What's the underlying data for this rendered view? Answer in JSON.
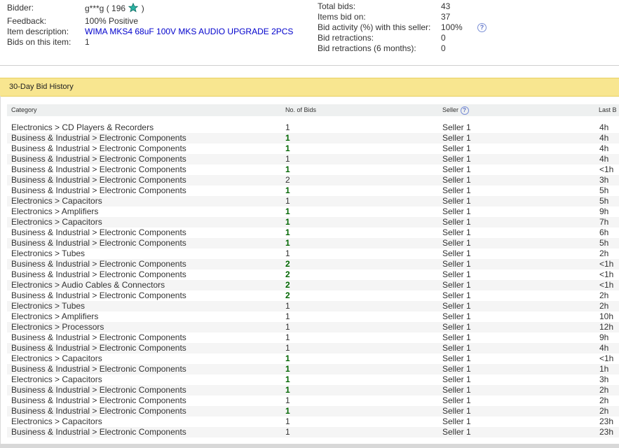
{
  "summary": {
    "bidder_label": "Bidder:",
    "bidder_name": "g***g",
    "bidder_score": "( 196",
    "bidder_score_close": ")",
    "feedback_label": "Feedback:",
    "feedback_value": "100% Positive",
    "item_desc_label": "Item description:",
    "item_desc_value": "WIMA MKS4 68uF 100V MKS AUDIO UPGRADE 2PCS",
    "bids_on_item_label": "Bids on this item:",
    "bids_on_item_value": "1",
    "total_bids_label": "Total bids:",
    "total_bids_value": "43",
    "items_bid_on_label": "Items bid on:",
    "items_bid_on_value": "37",
    "bid_activity_label": "Bid activity (%) with this seller:",
    "bid_activity_value": "100%",
    "bid_retractions_label": "Bid retractions:",
    "bid_retractions_value": "0",
    "bid_retractions_6m_label": "Bid retractions (6 months):",
    "bid_retractions_6m_value": "0"
  },
  "history": {
    "title": "30-Day Bid History",
    "columns": {
      "category": "Category",
      "bids": "No. of Bids",
      "seller": "Seller",
      "last": "Last B"
    },
    "rows": [
      {
        "category": "Electronics > CD Players & Recorders",
        "bids": "1",
        "seller": "Seller 1",
        "last": "4h",
        "green": false
      },
      {
        "category": "Business & Industrial > Electronic Components",
        "bids": "1",
        "seller": "Seller 1",
        "last": "4h",
        "green": true
      },
      {
        "category": "Business & Industrial > Electronic Components",
        "bids": "1",
        "seller": "Seller 1",
        "last": "4h",
        "green": true
      },
      {
        "category": "Business & Industrial > Electronic Components",
        "bids": "1",
        "seller": "Seller 1",
        "last": "4h",
        "green": false
      },
      {
        "category": "Business & Industrial > Electronic Components",
        "bids": "1",
        "seller": "Seller 1",
        "last": "<1h",
        "green": true
      },
      {
        "category": "Business & Industrial > Electronic Components",
        "bids": "2",
        "seller": "Seller 1",
        "last": "3h",
        "green": false
      },
      {
        "category": "Business & Industrial > Electronic Components",
        "bids": "1",
        "seller": "Seller 1",
        "last": "5h",
        "green": true
      },
      {
        "category": "Electronics > Capacitors",
        "bids": "1",
        "seller": "Seller 1",
        "last": "5h",
        "green": false
      },
      {
        "category": "Electronics > Amplifiers",
        "bids": "1",
        "seller": "Seller 1",
        "last": "9h",
        "green": true
      },
      {
        "category": "Electronics > Capacitors",
        "bids": "1",
        "seller": "Seller 1",
        "last": "7h",
        "green": true
      },
      {
        "category": "Business & Industrial > Electronic Components",
        "bids": "1",
        "seller": "Seller 1",
        "last": "6h",
        "green": true
      },
      {
        "category": "Business & Industrial > Electronic Components",
        "bids": "1",
        "seller": "Seller 1",
        "last": "5h",
        "green": true
      },
      {
        "category": "Electronics > Tubes",
        "bids": "1",
        "seller": "Seller 1",
        "last": "2h",
        "green": false
      },
      {
        "category": "Business & Industrial > Electronic Components",
        "bids": "2",
        "seller": "Seller 1",
        "last": "<1h",
        "green": true
      },
      {
        "category": "Business & Industrial > Electronic Components",
        "bids": "2",
        "seller": "Seller 1",
        "last": "<1h",
        "green": true
      },
      {
        "category": "Electronics > Audio Cables & Connectors",
        "bids": "2",
        "seller": "Seller 1",
        "last": "<1h",
        "green": true
      },
      {
        "category": "Business & Industrial > Electronic Components",
        "bids": "2",
        "seller": "Seller 1",
        "last": "2h",
        "green": true
      },
      {
        "category": "Electronics > Tubes",
        "bids": "1",
        "seller": "Seller 1",
        "last": "2h",
        "green": false
      },
      {
        "category": "Electronics > Amplifiers",
        "bids": "1",
        "seller": "Seller 1",
        "last": "10h",
        "green": false
      },
      {
        "category": "Electronics > Processors",
        "bids": "1",
        "seller": "Seller 1",
        "last": "12h",
        "green": false
      },
      {
        "category": "Business & Industrial > Electronic Components",
        "bids": "1",
        "seller": "Seller 1",
        "last": "9h",
        "green": false
      },
      {
        "category": "Business & Industrial > Electronic Components",
        "bids": "1",
        "seller": "Seller 1",
        "last": "4h",
        "green": false
      },
      {
        "category": "Electronics > Capacitors",
        "bids": "1",
        "seller": "Seller 1",
        "last": "<1h",
        "green": true
      },
      {
        "category": "Business & Industrial > Electronic Components",
        "bids": "1",
        "seller": "Seller 1",
        "last": "1h",
        "green": true
      },
      {
        "category": "Electronics > Capacitors",
        "bids": "1",
        "seller": "Seller 1",
        "last": "3h",
        "green": true
      },
      {
        "category": "Business & Industrial > Electronic Components",
        "bids": "1",
        "seller": "Seller 1",
        "last": "2h",
        "green": true
      },
      {
        "category": "Business & Industrial > Electronic Components",
        "bids": "1",
        "seller": "Seller 1",
        "last": "2h",
        "green": false
      },
      {
        "category": "Business & Industrial > Electronic Components",
        "bids": "1",
        "seller": "Seller 1",
        "last": "2h",
        "green": true
      },
      {
        "category": "Electronics > Capacitors",
        "bids": "1",
        "seller": "Seller 1",
        "last": "23h",
        "green": false
      },
      {
        "category": "Business & Industrial > Electronic Components",
        "bids": "1",
        "seller": "Seller 1",
        "last": "23h",
        "green": false
      }
    ]
  },
  "colors": {
    "header_bg": "#f8e690",
    "green": "#006600",
    "link_blue": "#0000cc",
    "star": "#2bb3a3"
  },
  "icons": {
    "star": "teal-star-icon",
    "help": "question-mark-icon"
  }
}
